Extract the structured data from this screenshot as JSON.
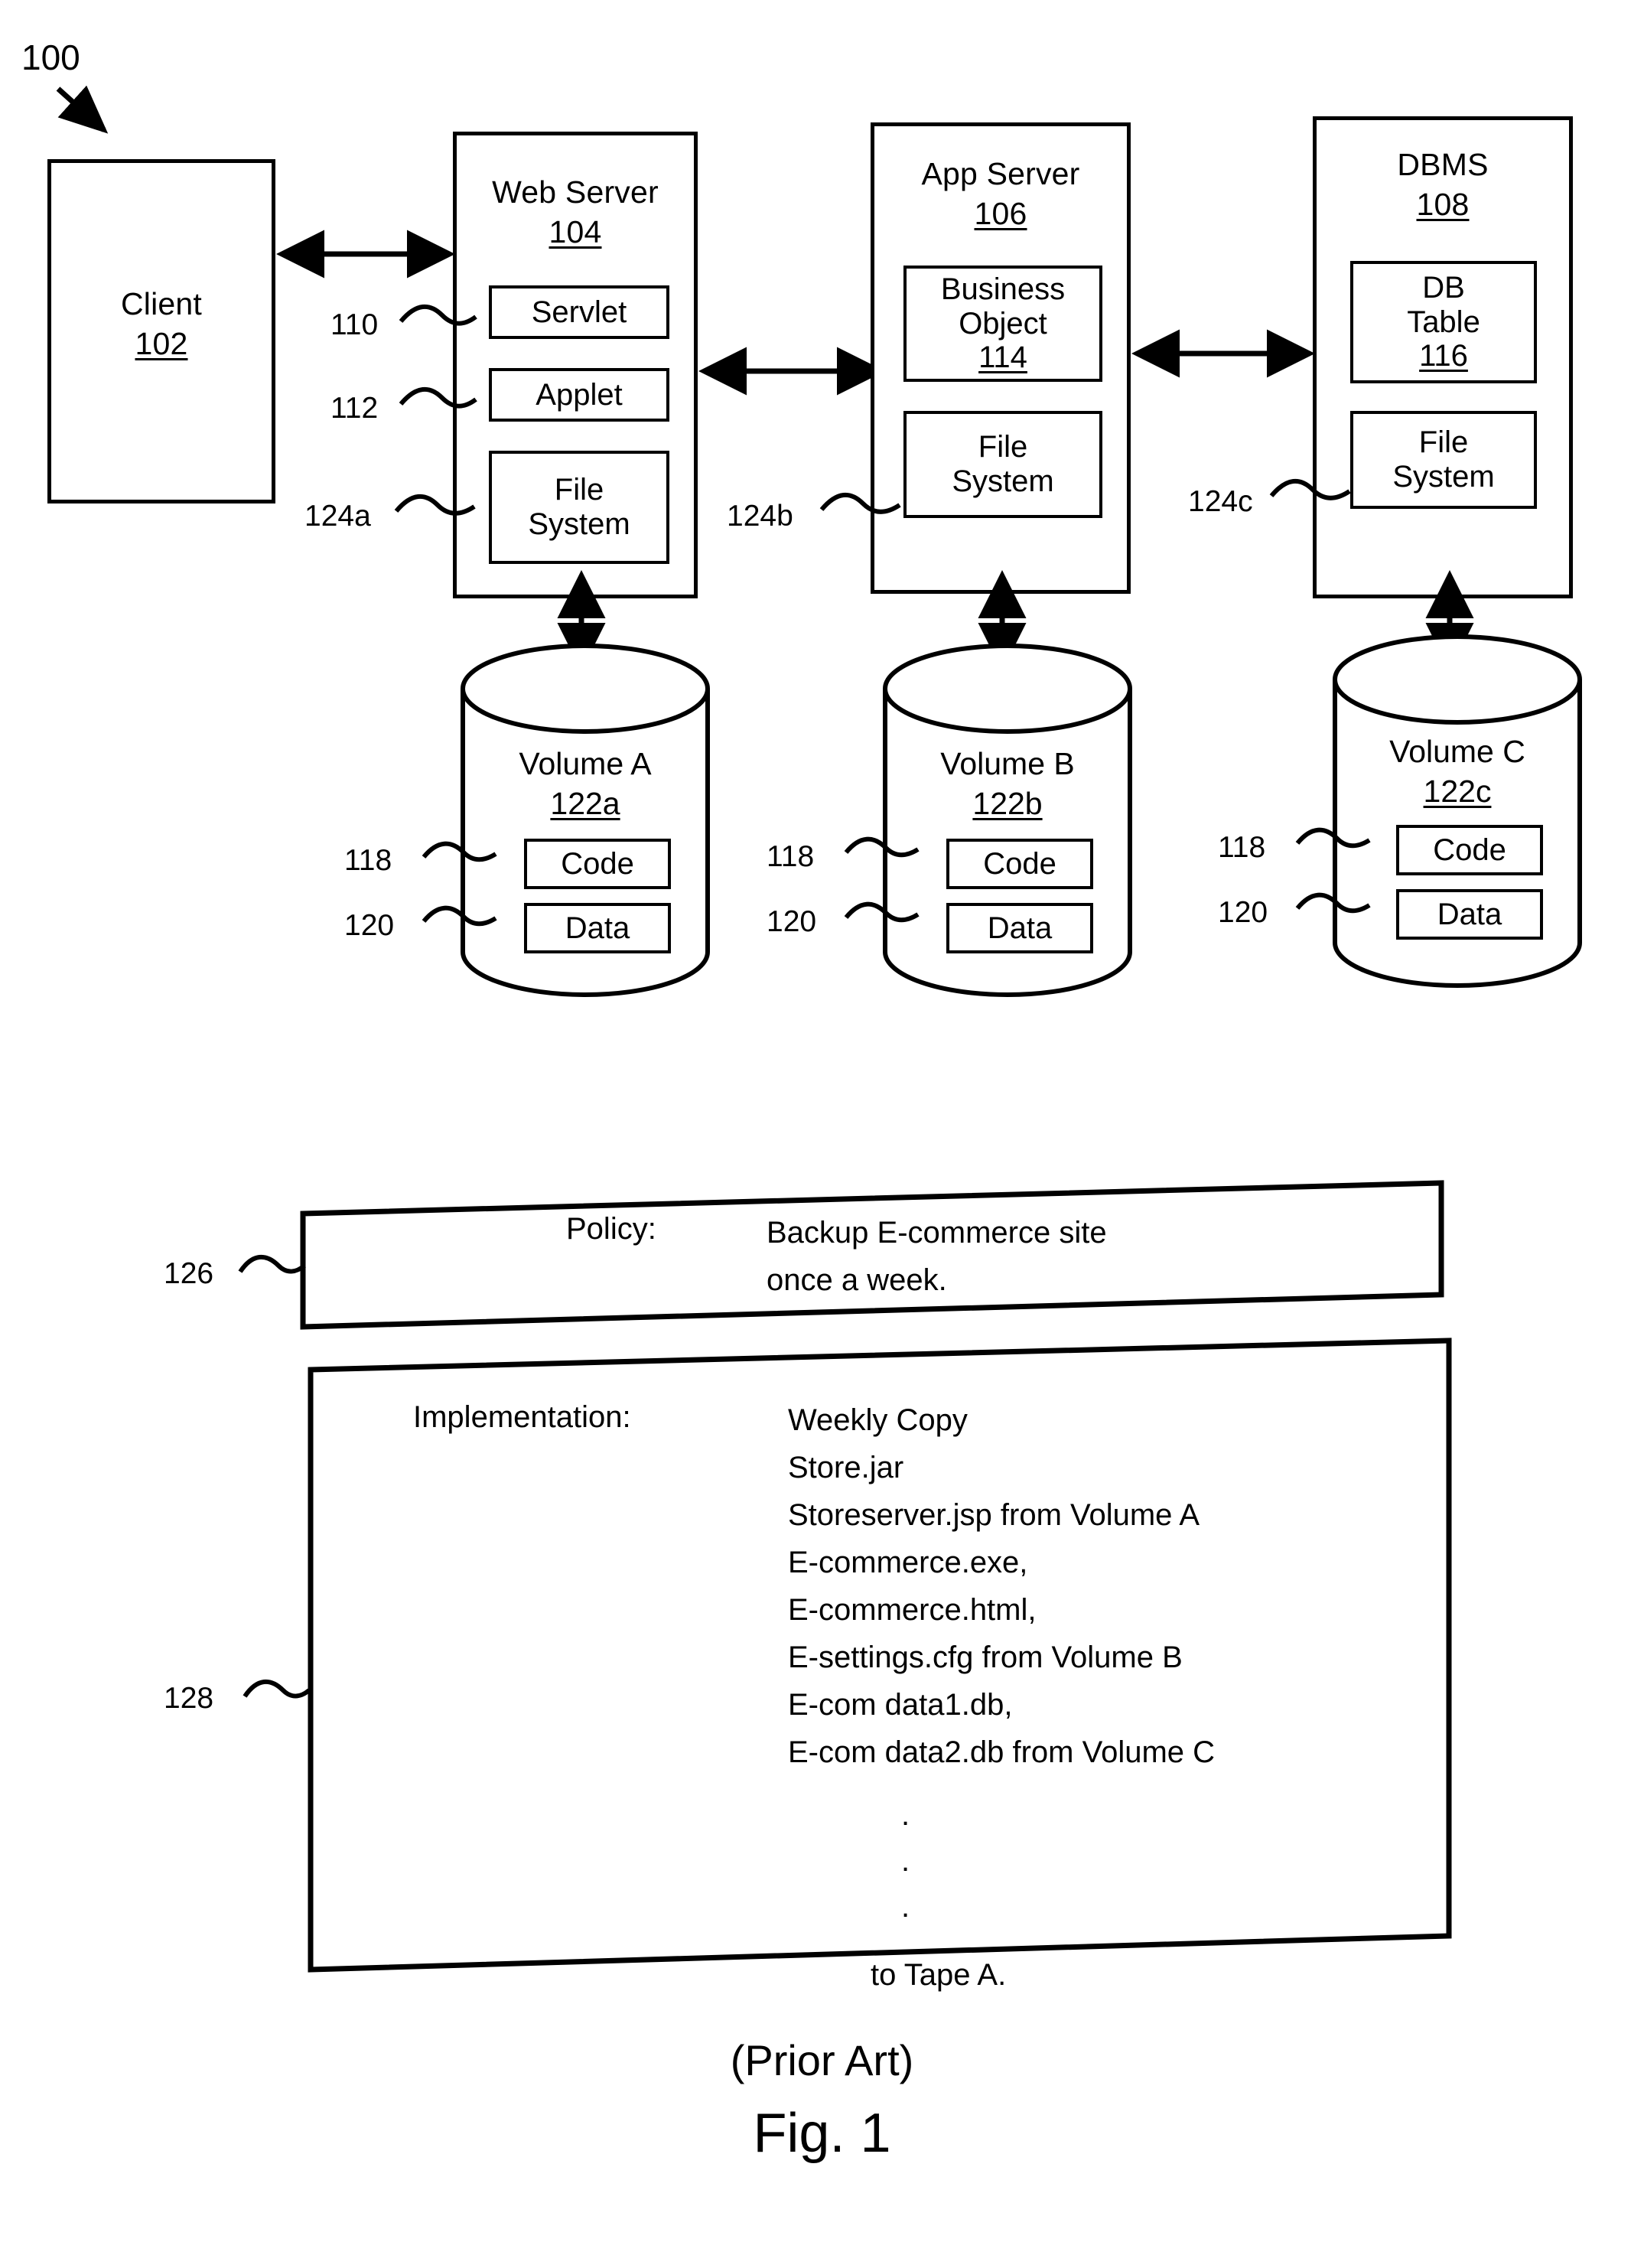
{
  "figure": {
    "system_ref": "100",
    "caption_prior": "(Prior Art)",
    "caption_fig": "Fig. 1"
  },
  "tier1": {
    "client": {
      "title": "Client",
      "ref": "102"
    },
    "web_server": {
      "title": "Web Server",
      "ref": "104",
      "components": [
        {
          "label": "Servlet",
          "ref": "110"
        },
        {
          "label": "Applet",
          "ref": "112"
        },
        {
          "label": "File System",
          "ref": "124a"
        }
      ]
    },
    "app_server": {
      "title": "App Server",
      "ref": "106",
      "components": [
        {
          "label": "Business Object",
          "ref": "114"
        },
        {
          "label": "File System",
          "ref": "124b"
        }
      ]
    },
    "dbms": {
      "title": "DBMS",
      "ref": "108",
      "components": [
        {
          "label": "DB Table",
          "ref": "116"
        },
        {
          "label": "File System",
          "ref": "124c"
        }
      ]
    }
  },
  "volumes": [
    {
      "title": "Volume A",
      "ref": "122a",
      "code": {
        "label": "Code",
        "ref": "118"
      },
      "data": {
        "label": "Data",
        "ref": "120"
      }
    },
    {
      "title": "Volume B",
      "ref": "122b",
      "code": {
        "label": "Code",
        "ref": "118"
      },
      "data": {
        "label": "Data",
        "ref": "120"
      }
    },
    {
      "title": "Volume C",
      "ref": "122c",
      "code": {
        "label": "Code",
        "ref": "118"
      },
      "data": {
        "label": "Data",
        "ref": "120"
      }
    }
  ],
  "policy_panel": {
    "ref": "126",
    "label": "Policy:",
    "lines": [
      "Backup E-commerce site",
      "once a week."
    ]
  },
  "implementation_panel": {
    "ref": "128",
    "label": "Implementation:",
    "lines": [
      "Weekly Copy",
      "Store.jar",
      "Storeserver.jsp from Volume A",
      "E-commerce.exe,",
      "E-commerce.html,",
      "E-settings.cfg from Volume B",
      "E-com data1.db,",
      "E-com data2.db from Volume C"
    ],
    "ellipsis": [
      ".",
      ".",
      "."
    ],
    "tail": "to Tape A."
  }
}
